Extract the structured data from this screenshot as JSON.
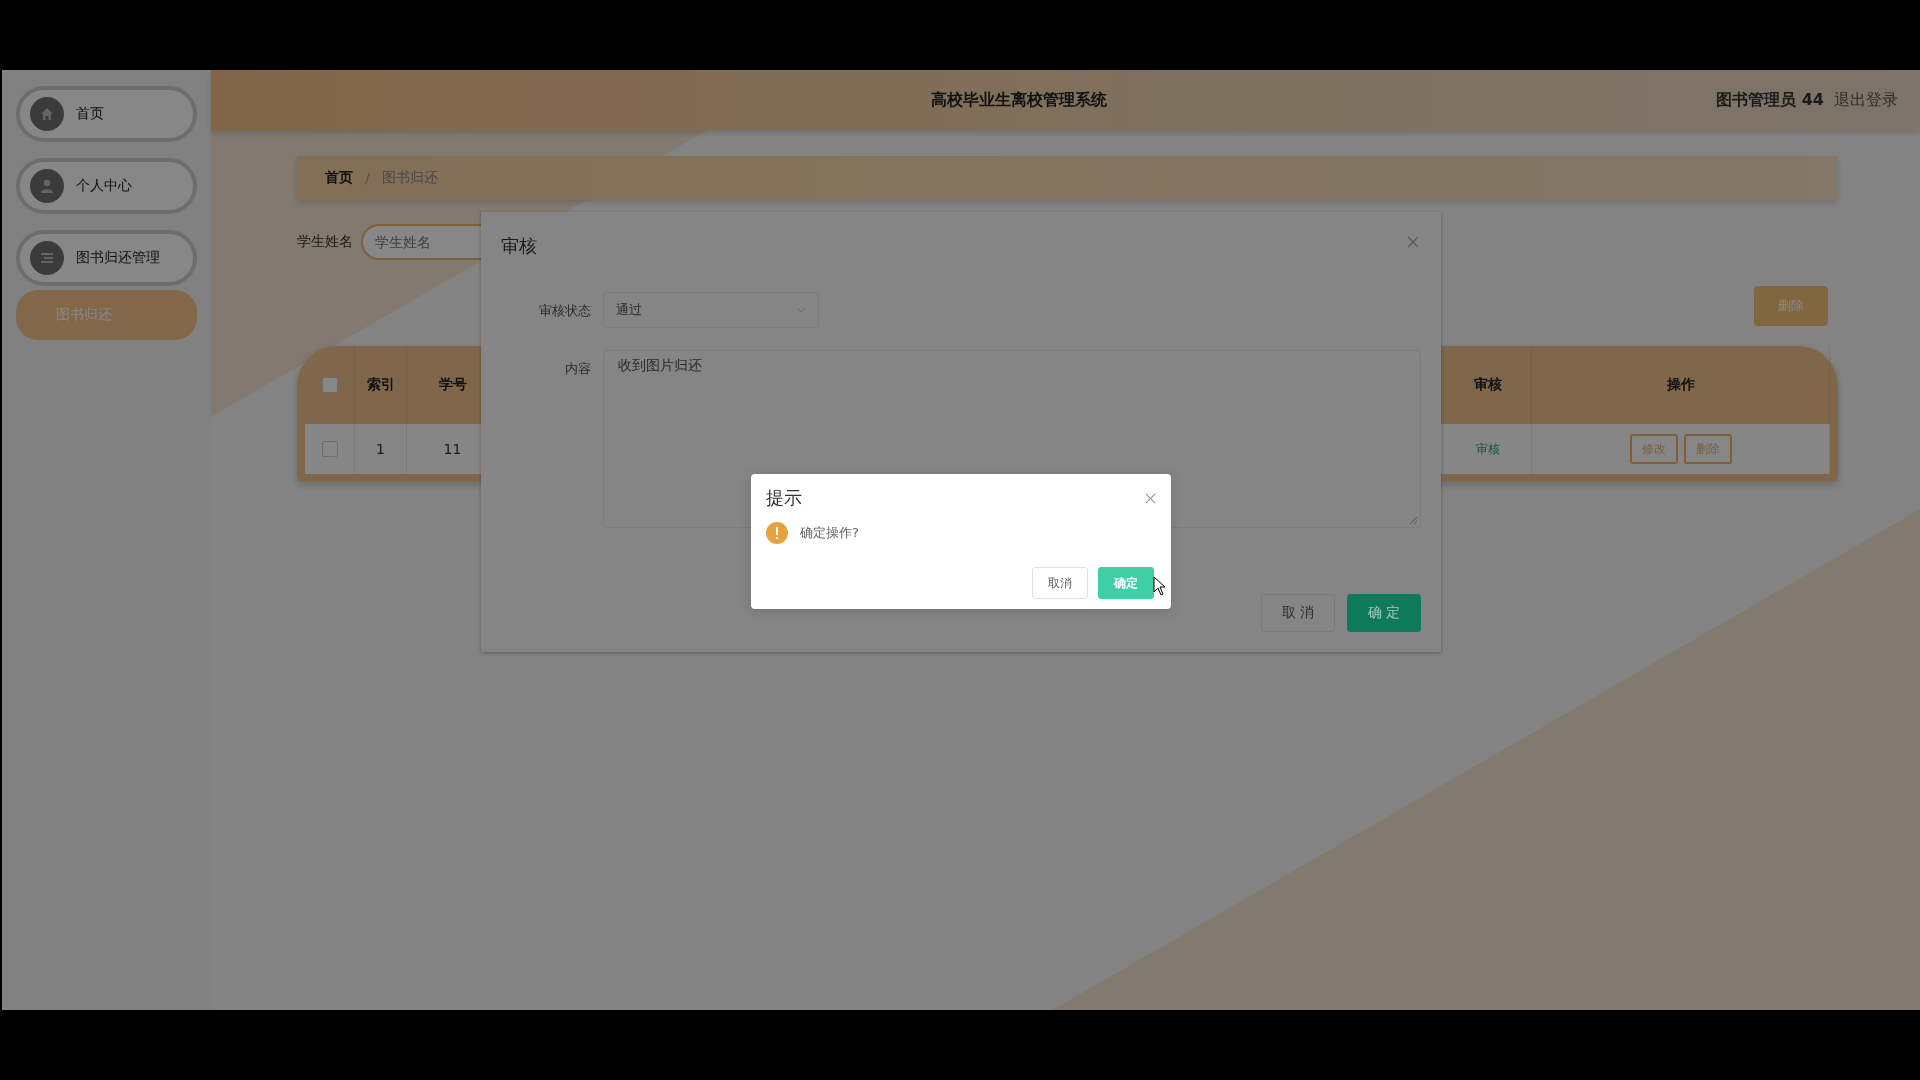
{
  "header": {
    "title": "高校毕业生离校管理系统",
    "user": "图书管理员 44",
    "logout": "退出登录"
  },
  "sidebar": {
    "items": [
      {
        "label": "首页",
        "kind": "home",
        "selected": false
      },
      {
        "label": "个人中心",
        "kind": "user",
        "selected": false
      },
      {
        "label": "图书归还管理",
        "kind": "list",
        "selected": false,
        "children": [
          {
            "label": "图书归还",
            "selected": true
          }
        ]
      }
    ]
  },
  "breadcrumb": [
    "首页",
    "图书归还"
  ],
  "breadcrumb_separator": "/",
  "search": {
    "label": "学生姓名",
    "placeholder": "学生姓名"
  },
  "delete_button": "删除",
  "table": {
    "select_all_checked": false,
    "columns": [
      "索引",
      "学号",
      "审核",
      "操作"
    ],
    "rows": [
      {
        "checked": false,
        "cells": [
          "1",
          "11"
        ],
        "review": "审核",
        "actions": [
          "修改",
          "删除"
        ]
      }
    ]
  },
  "dialog": {
    "title": "审核",
    "fields": [
      {
        "kind": "select",
        "label": "审核状态",
        "value": "通过"
      },
      {
        "kind": "textarea",
        "label": "内容",
        "value": "收到图片归还"
      }
    ],
    "buttons": [
      {
        "label": "取 消",
        "kind": "default"
      },
      {
        "label": "确 定",
        "kind": "primary"
      }
    ]
  },
  "message_box": {
    "title": "提示",
    "message": "确定操作?",
    "buttons": [
      {
        "label": "取消",
        "kind": "default"
      },
      {
        "label": "确定",
        "kind": "primary"
      }
    ]
  }
}
